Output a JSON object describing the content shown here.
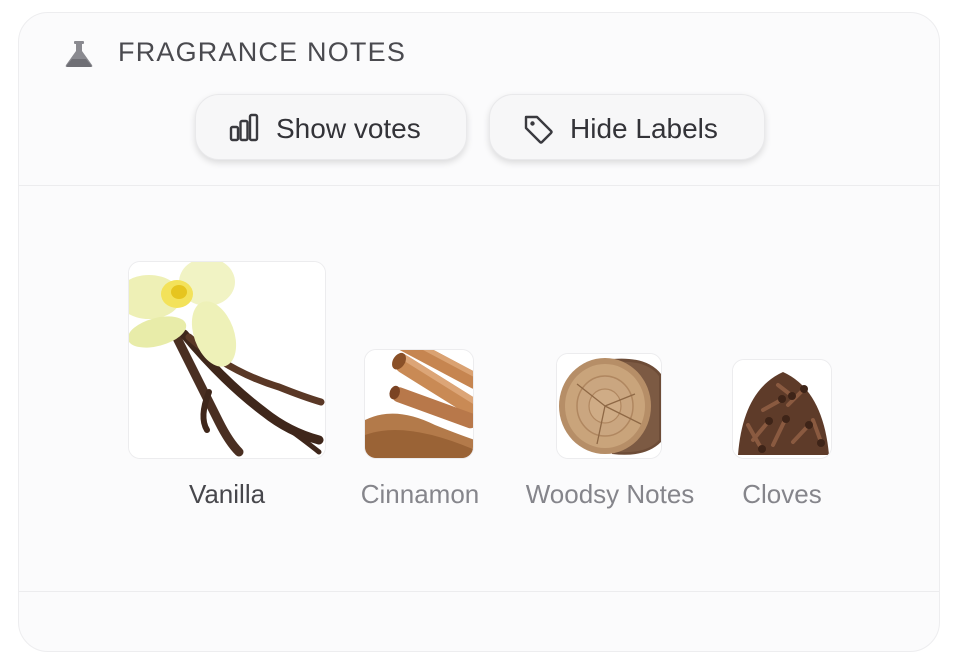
{
  "section": {
    "title": "FRAGRANCE NOTES",
    "icon": "flask-icon"
  },
  "buttons": {
    "show_votes": {
      "label": "Show votes",
      "icon": "bar-chart-icon"
    },
    "hide_labels": {
      "label": "Hide Labels",
      "icon": "tag-icon"
    }
  },
  "notes": [
    {
      "name": "Vanilla",
      "emphasis": "primary"
    },
    {
      "name": "Cinnamon",
      "emphasis": "secondary"
    },
    {
      "name": "Woodsy Notes",
      "emphasis": "secondary"
    },
    {
      "name": "Cloves",
      "emphasis": "secondary"
    }
  ],
  "colors": {
    "card_bg": "#fbfbfc",
    "text_primary": "#47474c",
    "text_secondary": "#85858b"
  }
}
